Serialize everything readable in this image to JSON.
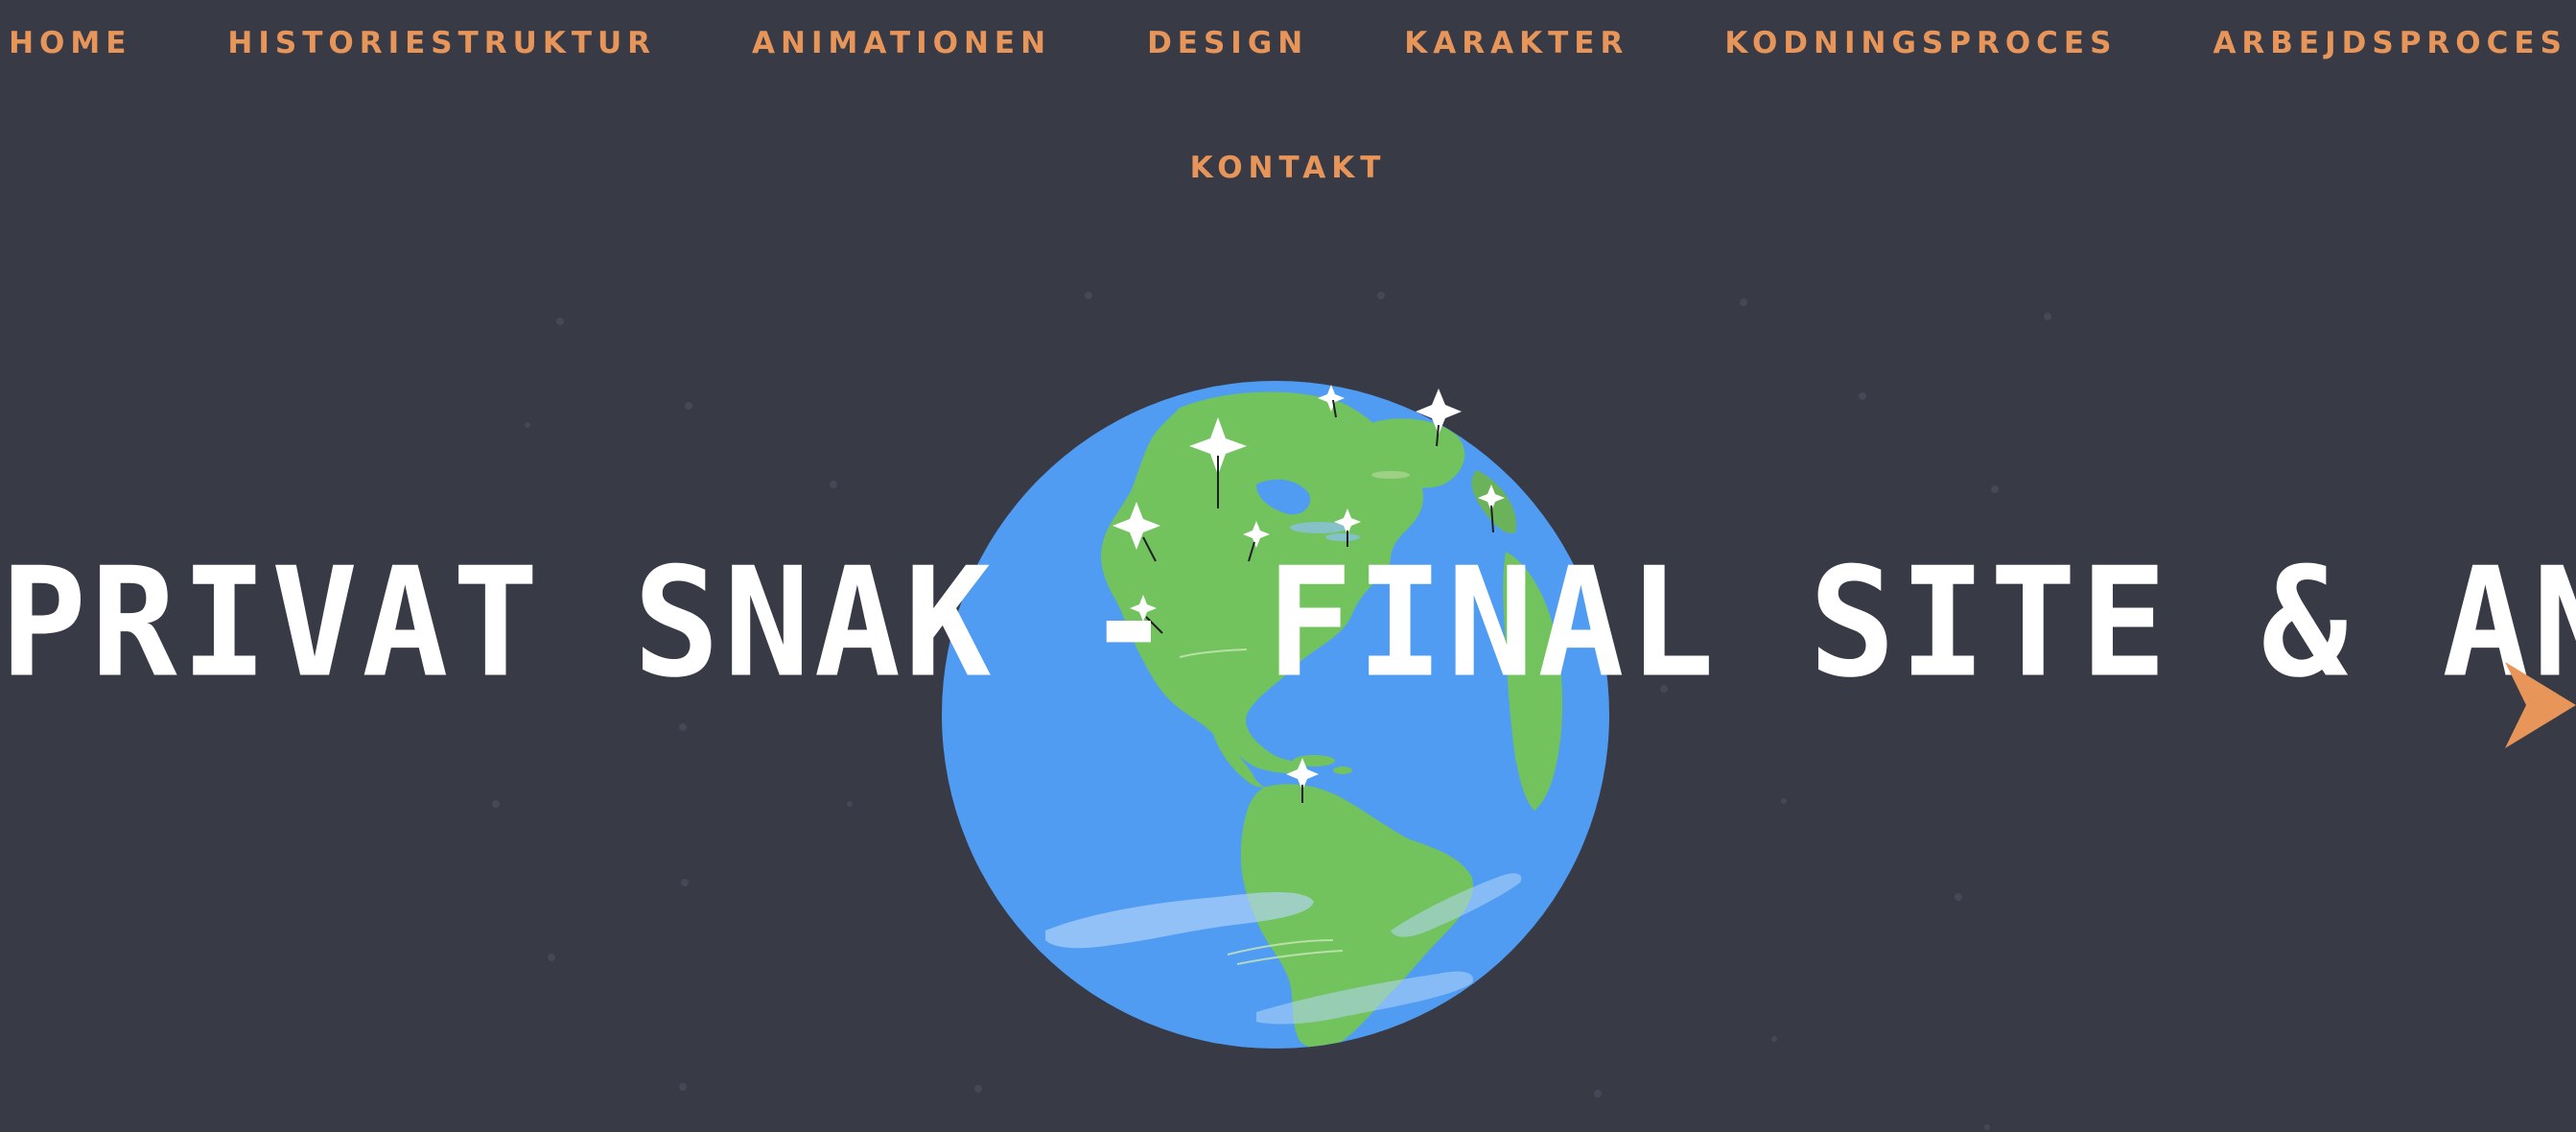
{
  "nav": {
    "items": [
      {
        "label": "HOME"
      },
      {
        "label": "HISTORIESTRUKTUR"
      },
      {
        "label": "ANIMATIONEN"
      },
      {
        "label": "DESIGN"
      },
      {
        "label": "KARAKTER"
      },
      {
        "label": "KODNINGSPROCES"
      },
      {
        "label": "ARBEJDSPROCES"
      },
      {
        "label": "KONTAKT"
      }
    ]
  },
  "hero": {
    "title": "PRIVAT SNAK - FINAL SITE & ANIMATION"
  },
  "icons": {
    "earth": "globe-illustration",
    "next": "arrow-right-icon"
  },
  "colors": {
    "background": "#383b46",
    "accent": "#e8955a",
    "ocean": "#4f9cf2",
    "land": "#72c35e",
    "title": "#ffffff"
  }
}
